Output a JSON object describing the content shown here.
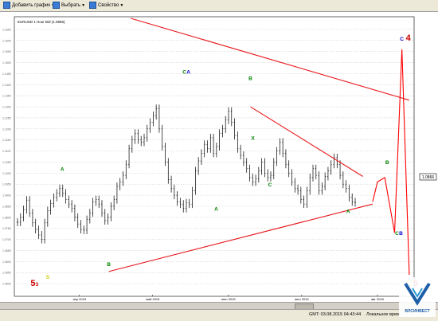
{
  "toolbar": {
    "add_chart_label": "Добавить график",
    "select_label": "Выбрать",
    "properties_label": "Свойство"
  },
  "chart_legend": "EURUSD 1 Hour Bid (1.0866)",
  "chart_data": {
    "type": "line",
    "series": [
      {
        "values": [
          1.0778,
          1.08,
          1.0835,
          1.0878,
          1.082,
          1.0775,
          1.0745,
          1.072,
          1.07,
          1.0775,
          1.083,
          1.0862,
          1.089,
          1.091,
          1.093,
          1.091,
          1.088,
          1.086,
          1.084,
          1.08,
          1.077,
          1.0745,
          1.0742,
          1.079,
          1.082,
          1.087,
          1.088,
          1.086,
          1.082,
          1.0785,
          1.08,
          1.085,
          1.088,
          1.094,
          1.096,
          1.099,
          1.104,
          1.111,
          1.115,
          1.118,
          1.115,
          1.114,
          1.116,
          1.12,
          1.123,
          1.126,
          1.1292,
          1.12,
          1.112,
          1.105,
          1.097,
          1.093,
          1.09,
          1.087,
          1.086,
          1.084,
          1.0865,
          1.086,
          1.092,
          1.101,
          1.1055,
          1.109,
          1.113,
          1.111,
          1.116,
          1.109,
          1.112,
          1.118,
          1.12,
          1.124,
          1.128,
          1.123,
          1.117,
          1.111,
          1.108,
          1.105,
          1.102,
          1.098,
          1.096,
          1.0975,
          1.101,
          1.105,
          1.1,
          1.098,
          1.099,
          1.105,
          1.11,
          1.114,
          1.109,
          1.104,
          1.1,
          1.096,
          1.093,
          1.092,
          1.088,
          1.086,
          1.092,
          1.098,
          1.102,
          1.099,
          1.092,
          1.094,
          1.0985,
          1.101,
          1.104,
          1.107,
          1.104,
          1.099,
          1.095,
          1.093,
          1.089,
          1.087,
          1.0866
        ],
        "color": "#000000"
      }
    ],
    "y_ticks": [
      "1.1650",
      "1.1600",
      "1.1550",
      "1.1500",
      "1.1450",
      "1.1400",
      "1.1350",
      "1.1300",
      "1.1250",
      "1.1200",
      "1.1150",
      "1.1100",
      "1.1050",
      "1.1000",
      "1.0950",
      "1.0900",
      "1.0850",
      "1.0800",
      "1.0750",
      "1.0700",
      "1.0650",
      "1.0600",
      "1.0550",
      "1.0500"
    ],
    "x_ticks": [
      "апр 2015",
      "май 2015",
      "июн 2015",
      "июл 2015",
      "авг 2015"
    ],
    "current_price_label": "1.0866",
    "ylim": [
      1.045,
      1.17
    ],
    "wave_labels": [
      {
        "date": "2015-03-19",
        "price": 1.0522,
        "text": "S",
        "color": "#cccc00"
      },
      {
        "date": "2015-03-13",
        "price": 1.049,
        "text": "5",
        "color": "#cc0000"
      },
      {
        "date": "2015-03-13",
        "price": 1.049,
        "text": "3",
        "color": "#cc0000"
      },
      {
        "date": "2015-03-25",
        "price": 1.101,
        "text": "A",
        "color": "#008000"
      },
      {
        "date": "2015-04-13",
        "price": 1.058,
        "text": "B",
        "color": "#008000"
      },
      {
        "date": "2015-05-14",
        "price": 1.145,
        "text": "C",
        "color": "#008000"
      },
      {
        "date": "2015-05-14",
        "price": 1.145,
        "text": "A",
        "color": "#0000cc"
      },
      {
        "date": "2015-05-27",
        "price": 1.083,
        "text": "A",
        "color": "#008000"
      },
      {
        "date": "2015-06-10",
        "price": 1.142,
        "text": "B",
        "color": "#008000"
      },
      {
        "date": "2015-06-11",
        "price": 1.115,
        "text": "X",
        "color": "#008000"
      },
      {
        "date": "2015-06-18",
        "price": 1.094,
        "text": "C",
        "color": "#008000"
      },
      {
        "date": "2015-07-20",
        "price": 1.082,
        "text": "A",
        "color": "#008000"
      },
      {
        "date": "2015-08-05",
        "price": 1.104,
        "text": "B",
        "color": "#008000"
      },
      {
        "date": "2015-08-09",
        "price": 1.072,
        "text": "C",
        "color": "#008000"
      },
      {
        "date": "2015-08-09",
        "price": 1.072,
        "text": "B",
        "color": "#0000cc"
      },
      {
        "date": "2015-08-11",
        "price": 1.16,
        "text": "C",
        "color": "#0000cc"
      },
      {
        "date": "2015-08-11",
        "price": 1.16,
        "text": "4",
        "color": "#cc0000"
      },
      {
        "date": "2015-08-14",
        "price": 1.049,
        "text": "C",
        "color": "#cccc00"
      },
      {
        "date": "2015-08-14",
        "price": 1.049,
        "text": "5",
        "color": "#cc0000"
      }
    ],
    "trendlines": [
      {
        "name": "upper-trendline",
        "from": {
          "date": "2015-04-22",
          "price": 1.17
        },
        "to": {
          "date": "2015-08-14",
          "price": 1.133
        }
      },
      {
        "name": "lower-trendline",
        "from": {
          "date": "2015-04-13",
          "price": 1.0555
        },
        "to": {
          "date": "2015-07-30",
          "price": 1.086
        }
      },
      {
        "name": "resistance-line",
        "from": {
          "date": "2015-06-10",
          "price": 1.13
        },
        "to": {
          "date": "2015-07-26",
          "price": 1.0985
        }
      }
    ],
    "projection": {
      "name": "forecast-path",
      "color": "#ff0000",
      "points": [
        {
          "date": "2015-07-30",
          "price": 1.087
        },
        {
          "date": "2015-08-01",
          "price": 1.096
        },
        {
          "date": "2015-08-04",
          "price": 1.098
        },
        {
          "date": "2015-08-08",
          "price": 1.073
        },
        {
          "date": "2015-08-11",
          "price": 1.156
        },
        {
          "date": "2015-08-14",
          "price": 1.054
        }
      ]
    }
  },
  "status": {
    "time_label": "GMT: 03.08.2015 04:43:44",
    "local_label": "Локальное врем"
  },
  "logo": {
    "text": "ВЛСИНВЕСТ",
    "color": "#1f5fa8"
  }
}
